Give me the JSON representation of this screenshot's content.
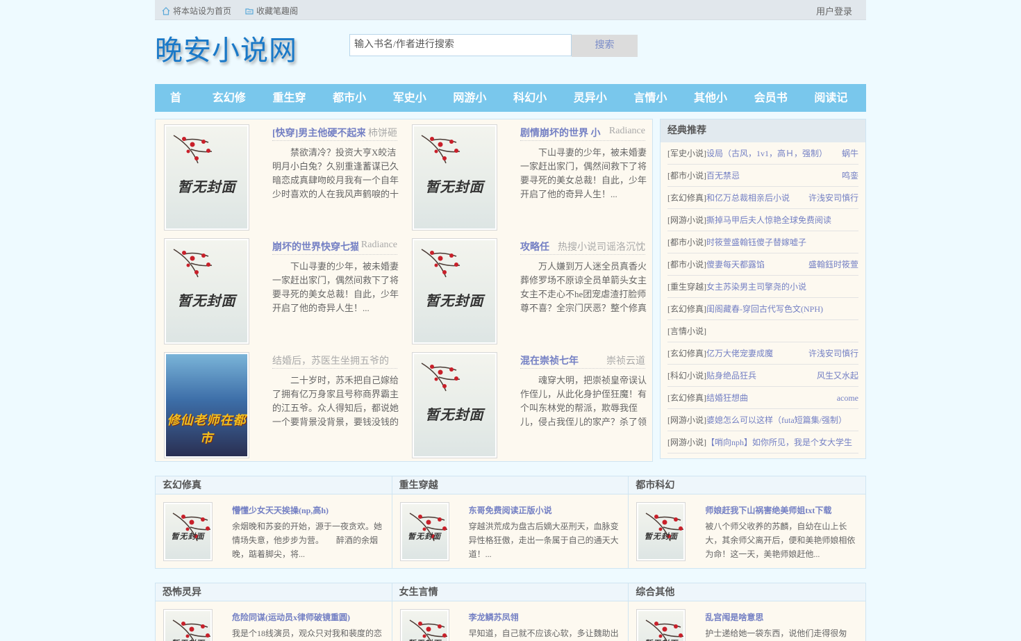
{
  "topbar": {
    "home_label": "将本站设为首页",
    "bookmark_label": "收藏笔趣阁",
    "login_label": "用户登录"
  },
  "header": {
    "logo": "晚安小说网",
    "search_placeholder": "输入书名/作者进行搜索",
    "search_button": "搜索"
  },
  "nav": [
    "首 页",
    "玄幻修真",
    "重生穿越",
    "都市小说",
    "军史小说",
    "网游小说",
    "科幻小说",
    "灵异小说",
    "言情小说",
    "其他小说",
    "会员书架",
    "阅读记录"
  ],
  "featured": [
    {
      "title": "[快穿]男主他硬不起来",
      "author": "柿饼砸",
      "desc": "禁欲清冷？投资大亨X皎洁明月小白兔？久别重逢蓄谋已久暗恋成真肆吻皎月我有一个自年少时喜欢的人在我风声鹤唳的十五六岁",
      "cover": "暂无封面",
      "title_muted": false
    },
    {
      "title": "剧情崩坏的世界 小",
      "author": "Radiance",
      "desc": "下山寻妻的少年，被未婚妻一家赶出家门，偶然间救下了将要寻死的美女总裁！自此，少年开启了他的奇异人生！...",
      "cover": "暂无封面",
      "title_muted": false
    },
    {
      "title": "崩坏的世界快穿七猫",
      "author": "Radiance",
      "desc": "下山寻妻的少年，被未婚妻一家赶出家门，偶然间救下了将要寻死的美女总裁！自此，少年开启了他的奇异人生！...",
      "cover": "暂无封面",
      "title_muted": false
    },
    {
      "title": "攻略任",
      "author": "热搜小说司谣洛沉忱",
      "desc": "万人嫌到万人迷全员真香火葬修罗场不原谅全员单箭头女主女主不走心不he团宠虐渣打脸师尊不喜？全宗门厌恶？整个修真界不",
      "cover": "暂无封面",
      "title_muted": false
    },
    {
      "title": "结婚后，苏医生坐拥五爷的",
      "author": "",
      "desc": "二十岁时，苏禾把自己嫁给了拥有亿万身家且号称商界霸主的江五爷。众人得知后，都说她一个要背景没背景，要钱没钱的乡下野丫",
      "cover": "修仙老师在都市",
      "title_muted": true
    },
    {
      "title": "混在崇祯七年",
      "author": "崇祯云道",
      "desc": "魂穿大明，把崇祯皇帝误认作侄儿，从此化身护侄狂魔！有个叫东林党的帮派，欺辱我侄儿，侵占我侄儿的家产？杀了领头的，灭了",
      "cover": "暂无封面",
      "title_muted": false
    }
  ],
  "sidebar": {
    "title": "经典推荐",
    "items": [
      {
        "cat": "[军史小说]",
        "book": "设局（古风，1v1，高Ｈ，强制）",
        "author": "蜗牛"
      },
      {
        "cat": "[都市小说]",
        "book": "百无禁忌",
        "author": "鸣銮"
      },
      {
        "cat": "[玄幻修真]",
        "book": "和亿万总裁相亲后小说",
        "author": "许浅安司慎行"
      },
      {
        "cat": "[网游小说]",
        "book": "撕掉马甲后夫人惊艳全球免费阅读",
        "author": ""
      },
      {
        "cat": "[都市小说]",
        "book": "时筱萱盛翰钰傻子替嫁嘘子",
        "author": ""
      },
      {
        "cat": "[都市小说]",
        "book": "傻妻每天都露馅",
        "author": "盛翰鈺时筱萱"
      },
      {
        "cat": "[重生穿越]",
        "book": "女主苏染男主司擎尧的小说",
        "author": ""
      },
      {
        "cat": "[玄幻修真]",
        "book": "闺阁藏春-穿回古代写色文(NPH)",
        "author": ""
      },
      {
        "cat": "[言情小说]",
        "book": "",
        "author": ""
      },
      {
        "cat": "[玄幻修真]",
        "book": "亿万大佬宠妻成魔",
        "author": "许浅安司慎行"
      },
      {
        "cat": "[科幻小说]",
        "book": "贴身绝品狂兵",
        "author": "风生又水起"
      },
      {
        "cat": "[玄幻修真]",
        "book": "结婚狂想曲",
        "author": "acome"
      },
      {
        "cat": "[网游小说]",
        "book": "婆媳怎么可以这样（futa短篇集/强制）",
        "author": ""
      },
      {
        "cat": "[网游小说]",
        "book": "【哨向nph】如你所见，我是个女大学生",
        "author": ""
      }
    ]
  },
  "categories_row1": [
    {
      "head": "玄幻修真",
      "title": "懵懂少女天天挨操(np,高h)",
      "desc": "余烟晚和苏妾的开始，源于一夜贪欢。她情场失意，他步步为营。　　醉酒的余烟晚，踮着脚尖，将...",
      "cover": "暂无封面"
    },
    {
      "head": "重生穿越",
      "title": "东哥免费阅读正版小说",
      "desc": "穿越洪荒成为盘古后嫡大巫刑天，血脉变异性格狂傲，走出一条属于自己的通天大道！...",
      "cover": "暂无封面"
    },
    {
      "head": "都市科幻",
      "title": "师娘赶我下山祸害绝美师姐txt下载",
      "desc": "被八个师父收养的苏麟，自幼在山上长大，其余师父离开后，便和美艳师娘相依为命！这一天，美艳师娘赶他...",
      "cover": "暂无封面"
    }
  ],
  "categories_row2": [
    {
      "head": "恐怖灵异",
      "title": "危险同谋(运动员x律师破镜重圆)",
      "desc": "我是个18线演员，观众只对我和裴度的恋",
      "cover": "暂无封面"
    },
    {
      "head": "女生言情",
      "title": "李龙鳞苏凤翎",
      "desc": "早知道，自己就不应该心软，多让魏助出",
      "cover": "暂无封面"
    },
    {
      "head": "综合其他",
      "title": "乱宫闱是啥意思",
      "desc": "护士递给她一袋东西，说他们走得很匆",
      "cover": "暂无封面"
    }
  ],
  "colors": {
    "accent": "#79c7ec",
    "link": "#7480c4",
    "logo": "#1a79c8",
    "panel": "#fdf9f0"
  }
}
